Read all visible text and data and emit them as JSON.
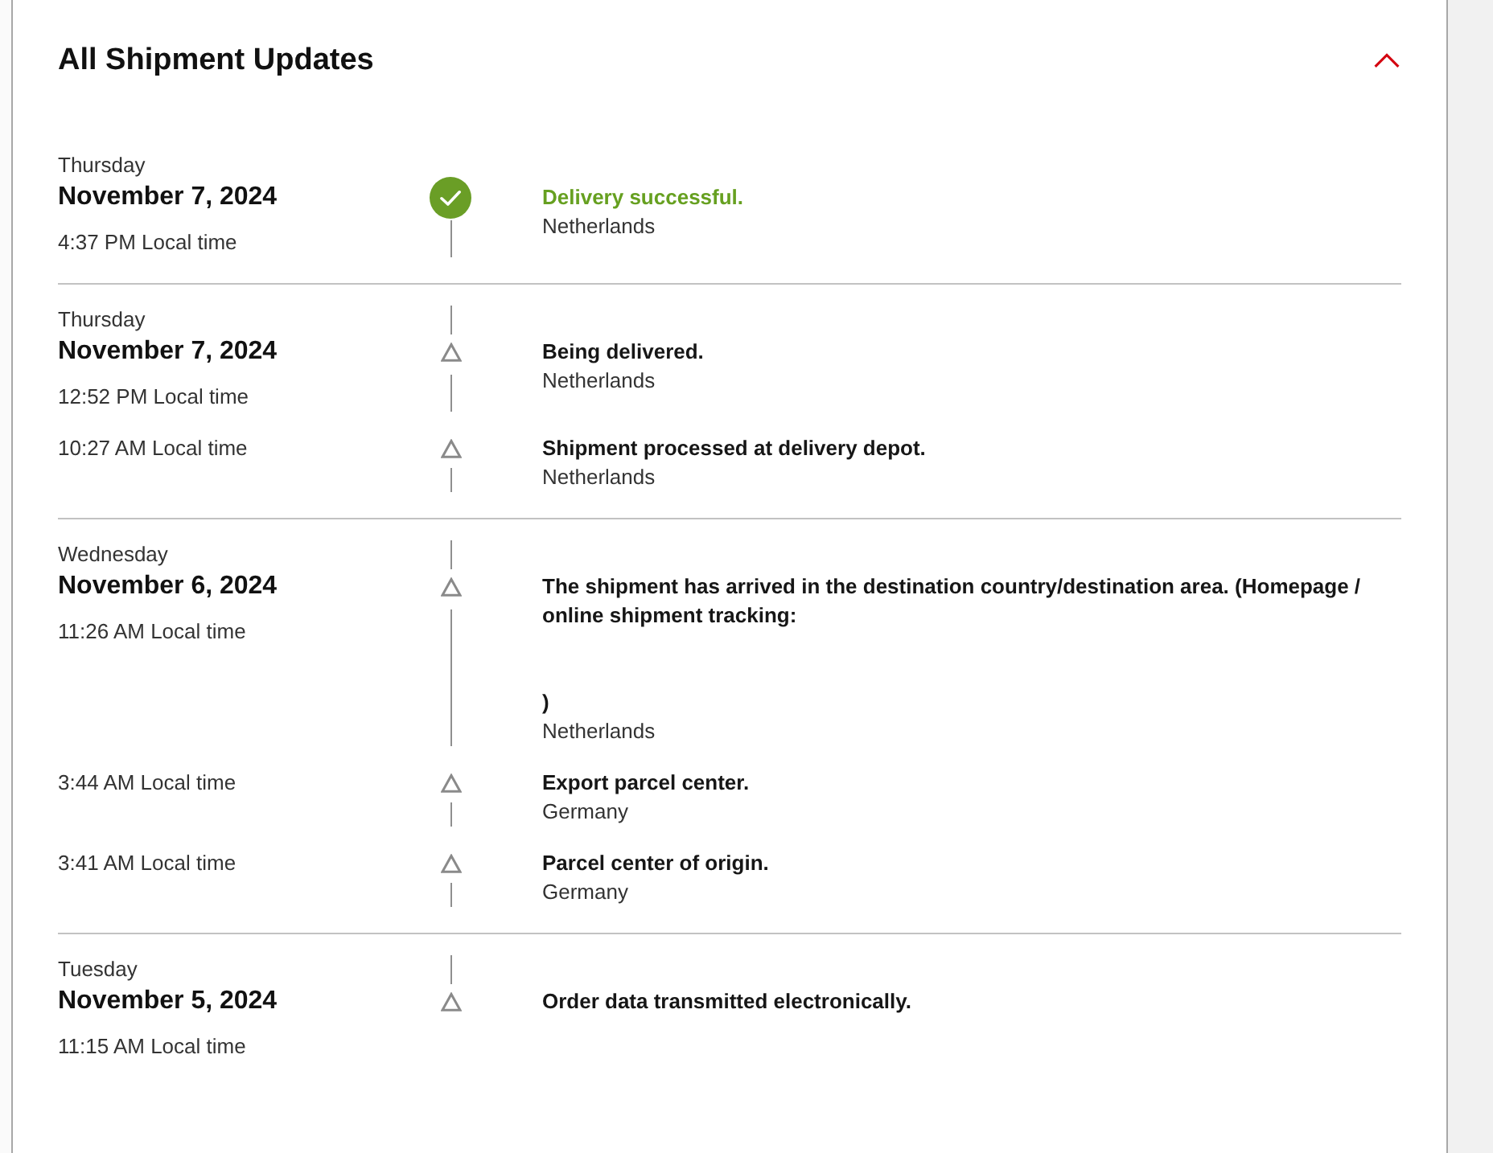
{
  "panel": {
    "title": "All Shipment Updates",
    "expanded": true
  },
  "groups": [
    {
      "day": "Thursday",
      "date": "November 7, 2024",
      "events": [
        {
          "kind": "delivered",
          "time": "4:37 PM Local time",
          "status": "Delivery successful.",
          "location": "Netherlands"
        }
      ]
    },
    {
      "day": "Thursday",
      "date": "November 7, 2024",
      "events": [
        {
          "kind": "transit",
          "time": "12:52 PM Local time",
          "status": "Being delivered.",
          "location": "Netherlands"
        },
        {
          "kind": "transit",
          "time": "10:27 AM Local time",
          "status": "Shipment processed at delivery depot.",
          "location": "Netherlands"
        }
      ]
    },
    {
      "day": "Wednesday",
      "date": "November 6, 2024",
      "events": [
        {
          "kind": "transit",
          "time": "11:26 AM Local time",
          "status": "The shipment has arrived in the destination country/destination area. (Homepage / online shipment tracking:\n\n\n)",
          "location": "Netherlands"
        },
        {
          "kind": "transit",
          "time": "3:44 AM Local time",
          "status": "Export parcel center.",
          "location": "Germany"
        },
        {
          "kind": "transit",
          "time": "3:41 AM Local time",
          "status": "Parcel center of origin.",
          "location": "Germany"
        }
      ]
    },
    {
      "day": "Tuesday",
      "date": "November 5, 2024",
      "events": [
        {
          "kind": "transit",
          "time": "11:15 AM Local time",
          "status": "Order data transmitted electronically."
        }
      ]
    }
  ]
}
